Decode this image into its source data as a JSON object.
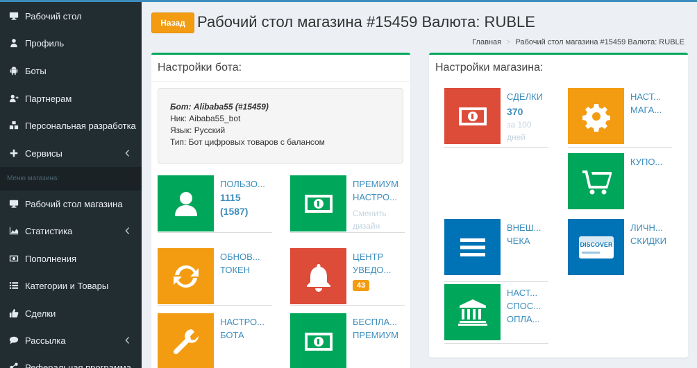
{
  "sidebar": {
    "items": [
      {
        "label": "Рабочий стол",
        "icon": "desktop-icon"
      },
      {
        "label": "Профиль",
        "icon": "user-icon"
      },
      {
        "label": "Боты",
        "icon": "android-icon"
      },
      {
        "label": "Партнерам",
        "icon": "user-plus-icon"
      },
      {
        "label": "Персональная разработка",
        "icon": "cubes-icon"
      },
      {
        "label": "Сервисы",
        "icon": "plus-icon"
      }
    ],
    "section_header": "Меню магазина:",
    "shop_items": [
      {
        "label": "Рабочий стол магазина",
        "icon": "desktop-icon"
      },
      {
        "label": "Статистика",
        "icon": "area-chart-icon"
      },
      {
        "label": "Пополнения",
        "icon": "money-icon"
      },
      {
        "label": "Категории и Товары",
        "icon": "list-icon"
      },
      {
        "label": "Сделки",
        "icon": "thumbs-up-icon"
      },
      {
        "label": "Рассылка",
        "icon": "comment-icon"
      },
      {
        "label": "Реферальная программа",
        "icon": "share-icon"
      }
    ]
  },
  "header": {
    "back_label": "Назад",
    "title": "Рабочий стол магазина #15459 Валюта: RUBLE"
  },
  "breadcrumb": {
    "home": "Главная",
    "separator": ">",
    "current": "Рабочий стол магазина #15459 Валюта: RUBLE"
  },
  "bot_box": {
    "title": "Настройки бота:",
    "info": {
      "bot_label": "Бот: Alibaba55 (#15459)",
      "nick": "Ник: Aibaba55_bot",
      "lang": "Язык: Русский",
      "type": "Тип: Бот цифровых товаров с балансом"
    },
    "tiles": {
      "users": {
        "title": "ПОЛЬЗО...",
        "value1": "1115",
        "value2": "(1587)",
        "icon": "user-icon"
      },
      "premium": {
        "title1": "ПРЕМИУМ",
        "title2": "НАСТРО...",
        "sub1": "Сменить",
        "sub2": "дизайн",
        "icon": "money-icon"
      },
      "token": {
        "title1": "ОБНОВ...",
        "title2": "ТОКЕН",
        "icon": "refresh-icon"
      },
      "notify": {
        "title1": "ЦЕНТР",
        "title2": "УВЕДО...",
        "badge": "43",
        "icon": "bell-icon"
      },
      "bot_settings": {
        "title1": "НАСТРО...",
        "title2": "БОТА",
        "icon": "wrench-icon"
      },
      "free_premium": {
        "title1": "БЕСПЛА...",
        "title2": "ПРЕМИУМ",
        "icon": "money-icon"
      }
    }
  },
  "shop_box": {
    "title": "Настройки магазина:",
    "tiles": {
      "deals": {
        "title": "СДЕЛКИ",
        "value": "370",
        "sub1": "за 100",
        "sub2": "дней",
        "icon": "money-icon"
      },
      "shop_settings": {
        "title1": "НАСТ...",
        "title2": "МАГА...",
        "icon": "gear-icon"
      },
      "coupons": {
        "title1": "КУПО...",
        "icon": "cart-plus-icon"
      },
      "external_check": {
        "title1": "ВНЕШ...",
        "title2": "ЧЕКА",
        "icon": "bars-icon"
      },
      "discounts": {
        "title1": "ЛИЧН...",
        "title2": "СКИДКИ",
        "icon": "credit-card-icon"
      },
      "payment": {
        "title1": "НАСТ...",
        "title2": "СПОС...",
        "title3": "ОПЛА...",
        "icon": "bank-icon"
      }
    }
  },
  "colors": {
    "green": "#00a65a",
    "orange": "#f39c12",
    "red": "#dd4b39",
    "blue": "#0073b7",
    "sidebar": "#222d32",
    "link": "#3c8dbc"
  }
}
